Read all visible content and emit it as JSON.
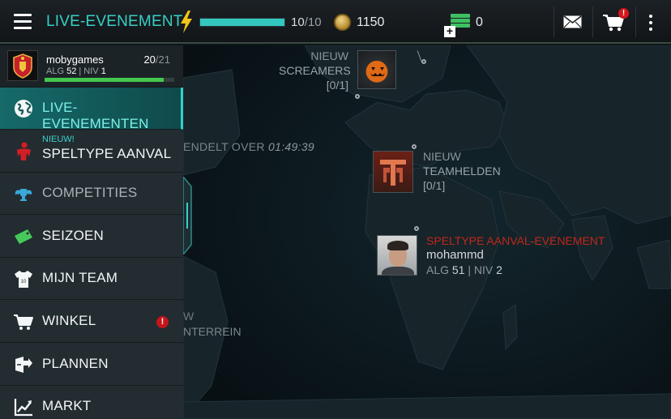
{
  "header": {
    "title": "LIVE-EVENEMENT",
    "energy_current": "10",
    "energy_max": "/10",
    "energy_fraction": 1.0,
    "coins": "1150",
    "cash": "0",
    "cart_badge": "!"
  },
  "profile": {
    "username": "mobygames",
    "count_current": "20",
    "count_max": "/21",
    "alg_label": "ALG",
    "alg_value": "52",
    "niv_label": "| NIV",
    "niv_value": "1",
    "xp_fraction": 0.92
  },
  "menu": {
    "items": [
      {
        "label": "LIVE-EVENEMENTEN",
        "icon": "globe-icon",
        "active": true
      },
      {
        "label": "SPELTYPE AANVAL",
        "icon": "attack-player-icon",
        "tag": "NIEUW!"
      },
      {
        "label": "COMPETITIES",
        "icon": "trophy-wings-icon"
      },
      {
        "label": "SEIZOEN",
        "icon": "ticket-icon"
      },
      {
        "label": "MIJN TEAM",
        "icon": "jersey-icon"
      },
      {
        "label": "WINKEL",
        "icon": "cart-icon",
        "alert": "!"
      },
      {
        "label": "PLANNEN",
        "icon": "plan-icon"
      },
      {
        "label": "MARKT",
        "icon": "chart-icon"
      }
    ]
  },
  "map": {
    "event1": {
      "tag": "NIEUW",
      "title": "SCREAMERS",
      "progress": "[0/1]"
    },
    "countdown_prefix": "ENDELT OVER",
    "countdown_time": "01:49:39",
    "event2": {
      "tag": "NIEUW",
      "title": "TEAMHELDEN",
      "progress": "[0/1]"
    },
    "event3": {
      "title": "SPELTYPE AANVAL-EVENEMENT",
      "opponent": "mohammd",
      "alg_label": "ALG",
      "alg_value": "51",
      "niv_label": "| NIV",
      "niv_value": "2"
    },
    "partial_tag": "W",
    "partial_title": "NTERREIN"
  },
  "colors": {
    "accent": "#36d0c6",
    "event_red": "#c0271b",
    "xp_green": "#44c74e",
    "alert_red": "#c5151b"
  }
}
